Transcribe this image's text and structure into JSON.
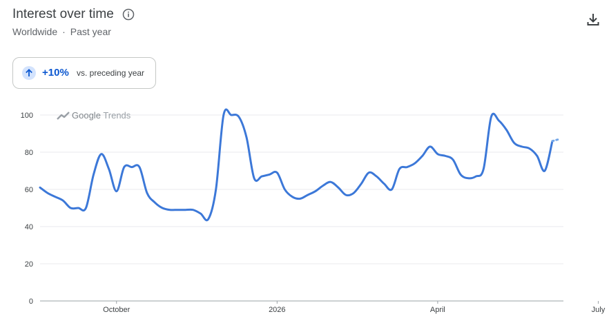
{
  "header": {
    "title": "Interest over time",
    "region": "Worldwide",
    "separator": "·",
    "period": "Past year"
  },
  "badge": {
    "change": "+10%",
    "comparison": "vs. preceding year"
  },
  "watermark": {
    "brand": "Google",
    "product": "Trends"
  },
  "icons": {
    "info": "info-icon",
    "download": "download-icon",
    "trend_up": "arrow-up-icon",
    "watermark": "trends-logo-icon"
  },
  "colors": {
    "line": "#3c78d8",
    "accent": "#0b57d0",
    "badge_bg": "#d3e3fd",
    "grid": "#e8eaed"
  },
  "chart_data": {
    "type": "line",
    "title": "Interest over time",
    "xlabel": "",
    "ylabel": "",
    "ylim": [
      0,
      100
    ],
    "yticks": [
      0,
      20,
      40,
      60,
      80,
      100
    ],
    "xtick_labels": [
      {
        "label": "October",
        "week": 10
      },
      {
        "label": "2026",
        "week": 31
      },
      {
        "label": "April",
        "week": 52
      },
      {
        "label": "July",
        "week": 73
      }
    ],
    "grid": true,
    "series": [
      {
        "values": [
          61,
          58,
          56,
          54,
          50,
          50,
          50,
          68,
          79,
          71,
          59,
          72,
          72,
          72,
          58,
          53,
          50,
          49,
          49,
          49,
          49,
          47,
          44,
          60,
          100,
          100,
          99,
          88,
          66,
          67,
          68,
          69,
          60,
          56,
          55,
          57,
          59,
          62,
          64,
          61,
          57,
          58,
          63,
          69,
          67,
          63,
          60,
          71,
          72,
          74,
          78,
          83,
          79,
          78,
          76,
          68,
          66,
          67,
          71,
          99,
          97,
          92,
          85,
          83,
          82,
          78,
          70,
          86
        ],
        "partial_last": 87
      }
    ]
  }
}
